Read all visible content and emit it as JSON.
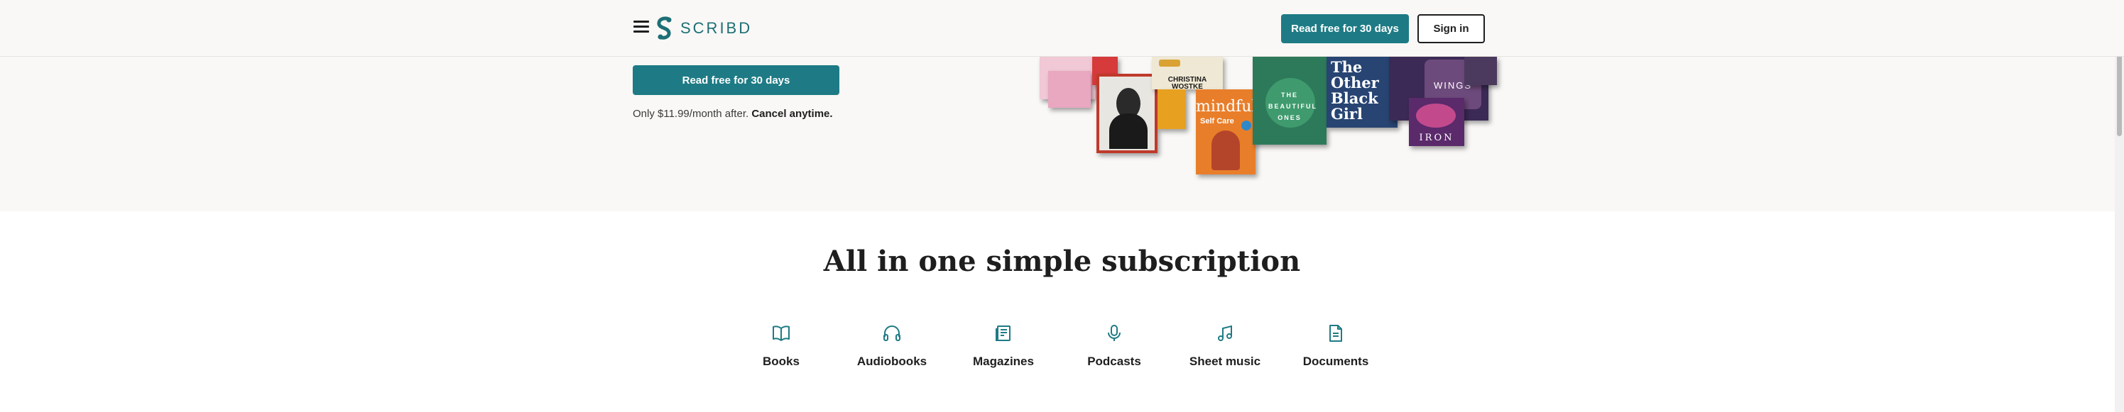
{
  "header": {
    "logo_text": "SCRIBD",
    "cta_label": "Read free for 30 days",
    "sign_in_label": "Sign in"
  },
  "hero": {
    "cta_label": "Read free for 30 days",
    "note_prefix": "Only $11.99/month after.",
    "note_emphasis": "Cancel anytime."
  },
  "collage": {
    "titles": [
      "CHRISTINA WOSTKE",
      "mindful",
      "Self Care",
      "THE BEAUTIFUL ONES",
      "The Other Black Girl",
      "WINGS",
      "IRON"
    ]
  },
  "section": {
    "title": "All in one simple subscription",
    "categories": [
      {
        "label": "Books",
        "icon": "book-icon"
      },
      {
        "label": "Audiobooks",
        "icon": "headphones-icon"
      },
      {
        "label": "Magazines",
        "icon": "magazine-icon"
      },
      {
        "label": "Podcasts",
        "icon": "microphone-icon"
      },
      {
        "label": "Sheet music",
        "icon": "music-note-icon"
      },
      {
        "label": "Documents",
        "icon": "document-icon"
      }
    ]
  },
  "colors": {
    "brand_teal": "#1e7b85",
    "hero_bg": "#f9f8f6"
  }
}
